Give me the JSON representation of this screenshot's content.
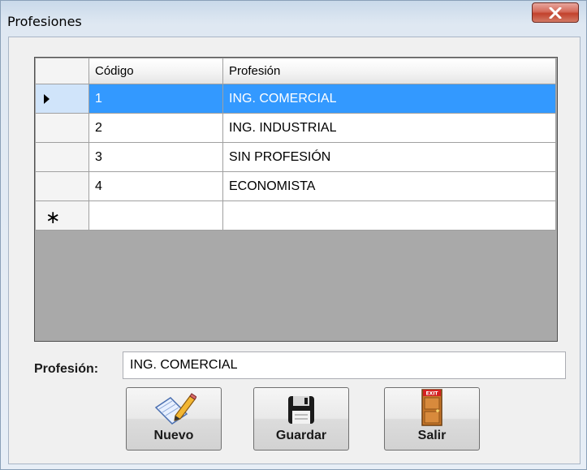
{
  "window": {
    "title": "Profesiones"
  },
  "grid": {
    "columns": [
      "Código",
      "Profesión"
    ],
    "rows": [
      {
        "codigo": "1",
        "profesion": "ING. COMERCIAL",
        "selected": true
      },
      {
        "codigo": "2",
        "profesion": "ING. INDUSTRIAL",
        "selected": false
      },
      {
        "codigo": "3",
        "profesion": "SIN PROFESIÓN",
        "selected": false
      },
      {
        "codigo": "4",
        "profesion": "ECONOMISTA",
        "selected": false
      }
    ],
    "new_row_marker": "∗"
  },
  "form": {
    "label": "Profesión:",
    "value": "ING. COMERCIAL"
  },
  "buttons": {
    "nuevo": {
      "label": "Nuevo",
      "icon": "edit-pencil-icon"
    },
    "guardar": {
      "label": "Guardar",
      "icon": "floppy-disk-icon"
    },
    "salir": {
      "label": "Salir",
      "icon": "exit-door-icon",
      "icon_text": "EXIT"
    }
  },
  "colors": {
    "selection": "#3399ff",
    "grid_background": "#a9a9a9",
    "close_button": "#c2412c"
  }
}
